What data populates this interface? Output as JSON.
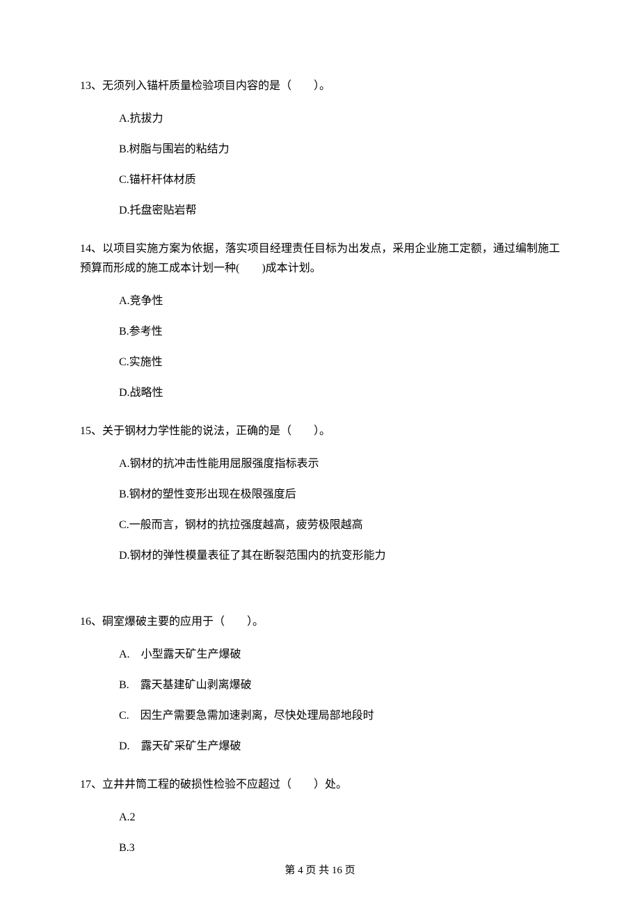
{
  "questions": [
    {
      "num": "13、",
      "stem": "无须列入锚杆质量检验项目内容的是（　　）。",
      "options": [
        "A.抗拔力",
        "B.树脂与围岩的粘结力",
        "C.锚杆杆体材质",
        "D.托盘密贴岩帮"
      ]
    },
    {
      "num": "14、",
      "stem": "以项目实施方案为依据，落实项目经理责任目标为出发点，采用企业施工定额，通过编制施工预算而形成的施工成本计划一种(　　)成本计划。",
      "options": [
        "A.竞争性",
        "B.参考性",
        "C.实施性",
        "D.战略性"
      ]
    },
    {
      "num": "15、",
      "stem": "关于钢材力学性能的说法，正确的是（　　）。",
      "options": [
        "A.钢材的抗冲击性能用屈服强度指标表示",
        "B.钢材的塑性变形出现在极限强度后",
        "C.一般而言，钢材的抗拉强度越高，疲劳极限越高",
        "D.钢材的弹性模量表征了其在断裂范围内的抗变形能力"
      ]
    },
    {
      "num": "16、",
      "stem": "硐室爆破主要的应用于（　　）。",
      "options": [
        "A.　小型露天矿生产爆破",
        "B.　露天基建矿山剥离爆破",
        "C.　因生产需要急需加速剥离，尽快处理局部地段时",
        "D.　露天矿采矿生产爆破"
      ]
    },
    {
      "num": "17、",
      "stem": "立井井筒工程的破损性检验不应超过（　　）处。",
      "options": [
        "A.2",
        "B.3"
      ]
    }
  ],
  "footer": "第 4 页 共 16 页"
}
